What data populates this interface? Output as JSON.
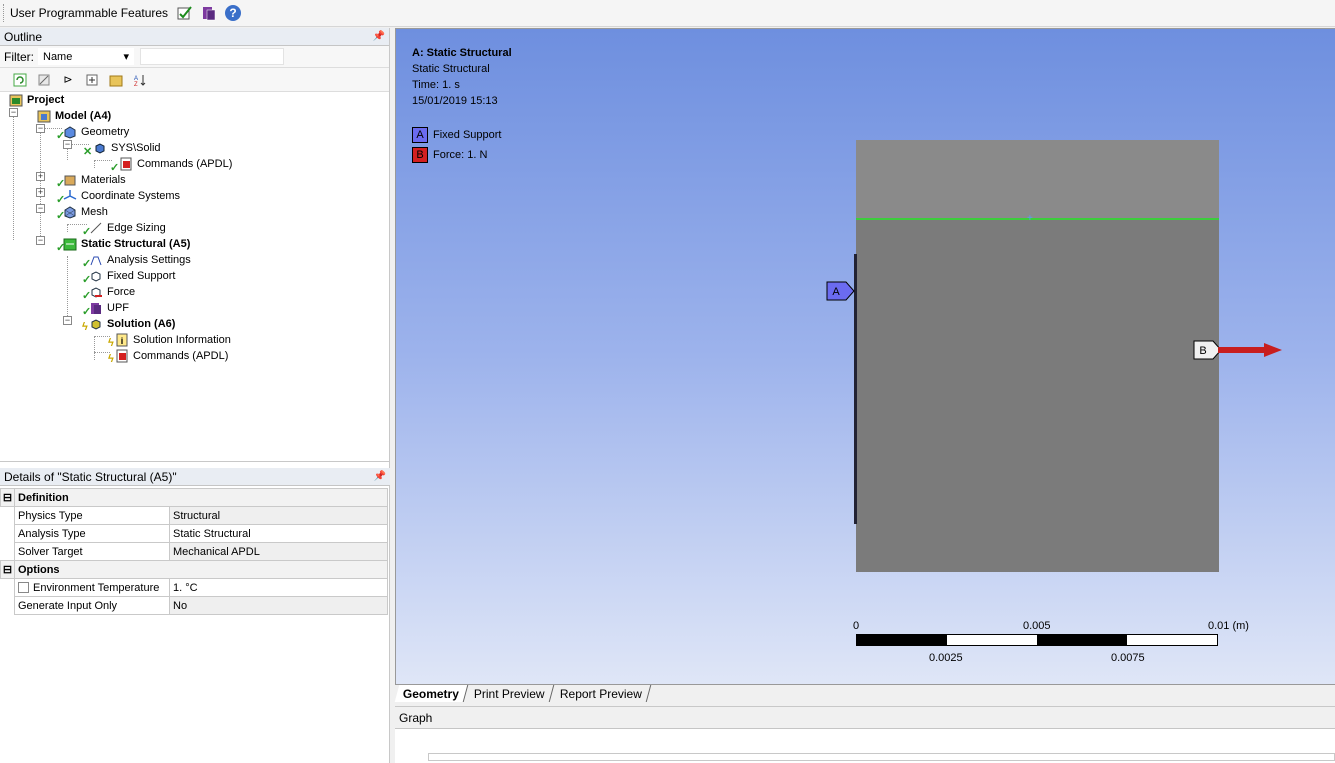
{
  "toolbar": {
    "title": "User Programmable Features"
  },
  "outline": {
    "header": "Outline",
    "filter_label": "Filter:",
    "filter_value": "Name",
    "tree": {
      "project": "Project",
      "model": "Model (A4)",
      "geometry": "Geometry",
      "sys_solid": "SYS\\Solid",
      "commands1": "Commands (APDL)",
      "materials": "Materials",
      "coord": "Coordinate Systems",
      "mesh": "Mesh",
      "edge_sizing": "Edge Sizing",
      "static": "Static Structural (A5)",
      "analysis_settings": "Analysis Settings",
      "fixed_support": "Fixed Support",
      "force": "Force",
      "upf": "UPF",
      "solution": "Solution (A6)",
      "solution_info": "Solution Information",
      "commands2": "Commands (APDL)"
    }
  },
  "details": {
    "header": "Details of \"Static Structural (A5)\"",
    "groups": {
      "definition": "Definition",
      "options": "Options"
    },
    "rows": {
      "physics_type": {
        "label": "Physics Type",
        "value": "Structural"
      },
      "analysis_type": {
        "label": "Analysis Type",
        "value": "Static Structural"
      },
      "solver_target": {
        "label": "Solver Target",
        "value": "Mechanical APDL"
      },
      "env_temp": {
        "label": "Environment Temperature",
        "value": "1. °C"
      },
      "gen_input": {
        "label": "Generate Input Only",
        "value": "No"
      }
    }
  },
  "viewport": {
    "title": "A: Static Structural",
    "subtitle": "Static Structural",
    "time": "Time: 1. s",
    "date": "15/01/2019 15:13",
    "legend": {
      "a_tag": "A",
      "a_label": "Fixed Support",
      "b_tag": "B",
      "b_label": "Force: 1. N"
    },
    "callout_a": "A",
    "callout_b": "B",
    "scale": {
      "s0": "0",
      "s005": "0.005",
      "s01": "0.01 (m)",
      "s0025": "0.0025",
      "s0075": "0.0075"
    },
    "colors": {
      "fixed": "#6b6bf0",
      "force": "#d42020"
    }
  },
  "tabs": {
    "geometry": "Geometry",
    "print": "Print Preview",
    "report": "Report Preview"
  },
  "graph": {
    "header": "Graph"
  }
}
